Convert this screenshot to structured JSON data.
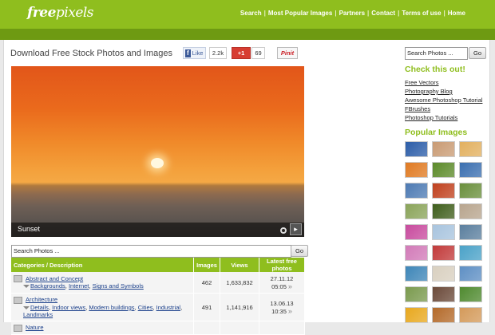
{
  "header": {
    "logo_a": "free",
    "logo_b": "pixels",
    "nav": [
      "Search",
      "Most Popular Images",
      "Partners",
      "Contact",
      "Terms of use",
      "Home"
    ],
    "separator": "|"
  },
  "main": {
    "title": "Download Free Stock Photos and Images",
    "social": {
      "fb_icon": "f",
      "fb_label": "Like",
      "fb_count": "2.2k",
      "gplus_label": "+1",
      "gplus_count": "69",
      "pin_label": "Pinit"
    },
    "hero_caption": "Sunset",
    "search_value": "Search Photos ...",
    "go_label": "Go"
  },
  "table": {
    "headers": [
      "Categories / Description",
      "Images",
      "Views",
      "Latest free photos"
    ],
    "rows": [
      {
        "name": "Abstract and Concept",
        "subs": [
          "Backgrounds",
          "Internet",
          "Signs and Symbols"
        ],
        "images": "462",
        "views": "1,633,832",
        "latest": "27.11.12 05:05"
      },
      {
        "name": "Architecture",
        "subs": [
          "Details",
          "Indoor views",
          "Modern buildings",
          "Cities",
          "Industrial",
          "Landmarks"
        ],
        "images": "491",
        "views": "1,141,916",
        "latest": "13.06.13 10:35"
      },
      {
        "name": "Nature",
        "subs": [],
        "images": "",
        "views": "",
        "latest": ""
      }
    ]
  },
  "sidebar": {
    "search_value": "Search Photos ...",
    "go_label": "Go",
    "check_title": "Check this out!",
    "links": [
      "Free Vectors",
      "Photography Blog",
      "Awesome Photoshop Tutorial",
      "FBrushes",
      "Photoshop Tutorials"
    ],
    "popular_title": "Popular Images",
    "thumb_colors": [
      "#2c5da8",
      "#c99b74",
      "#e2b05f",
      "#e07a22",
      "#5c8a2a",
      "#3b6fb0",
      "#4d7ab3",
      "#c0411e",
      "#6a8f3c",
      "#8aa45a",
      "#3f5e1c",
      "#b8a58e",
      "#c84b9e",
      "#a8c4de",
      "#5b7f9e",
      "#d27ab8",
      "#c23a3a",
      "#4aa2c8",
      "#3e86b8",
      "#d9d0c0",
      "#5e8fc4",
      "#7a9a4e",
      "#6b4a3a",
      "#4f8a2f",
      "#e8a81e",
      "#b46a2a",
      "#d49a5a"
    ]
  }
}
